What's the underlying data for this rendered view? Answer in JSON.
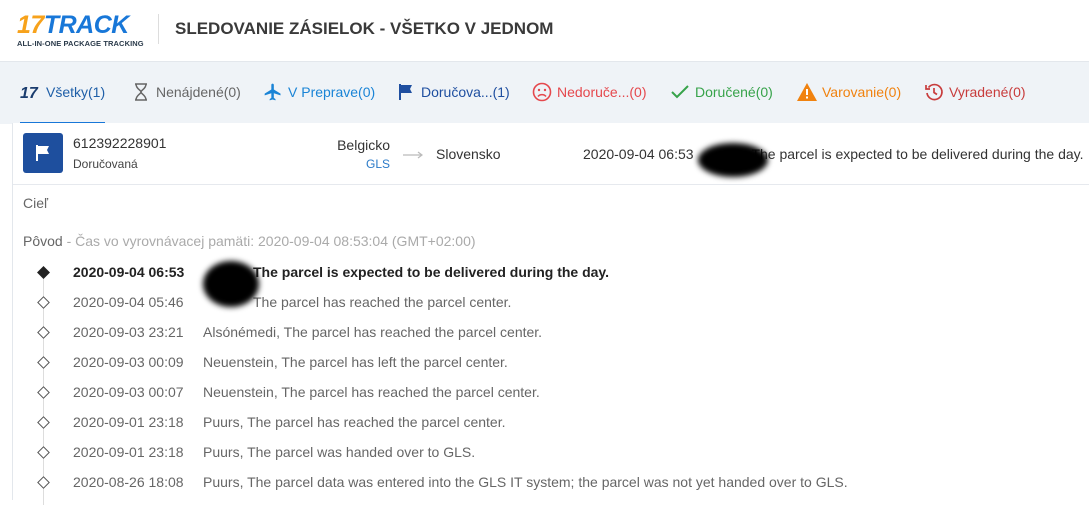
{
  "header": {
    "logo_number": "17",
    "logo_word": "TRACK",
    "logo_tagline": "ALL-IN-ONE PACKAGE TRACKING",
    "title": "SLEDOVANIE ZÁSIELOK - VŠETKO V JEDNOM"
  },
  "tabs": [
    {
      "label": "Všetky(1)",
      "icon": "17-icon"
    },
    {
      "label": "Nenájdené(0)",
      "icon": "hourglass-icon"
    },
    {
      "label": "V Preprave(0)",
      "icon": "airplane-icon"
    },
    {
      "label": "Doručova...(1)",
      "icon": "flag-icon"
    },
    {
      "label": "Nedoruče...(0)",
      "icon": "sad-face-icon"
    },
    {
      "label": "Doručené(0)",
      "icon": "check-icon"
    },
    {
      "label": "Varovanie(0)",
      "icon": "warning-icon"
    },
    {
      "label": "Vyradené(0)",
      "icon": "history-icon"
    }
  ],
  "shipment": {
    "tracking_number": "612392228901",
    "status": "Doručovaná",
    "origin_country": "Belgicko",
    "carrier": "GLS",
    "destination_country": "Slovensko",
    "last_event_time": "2020-09-04 06:53",
    "last_event_text": "The parcel is expected to be delivered during the day."
  },
  "sections": {
    "destination_label": "Cieľ",
    "origin_label": "Pôvod",
    "cache_note": " - Čas vo vyrovnávacej pamäti: 2020-09-04 08:53:04 (GMT+02:00)"
  },
  "events": [
    {
      "time": "2020-09-04 06:53",
      "text": "The parcel is expected to be delivered during the day."
    },
    {
      "time": "2020-09-04 05:46",
      "text": "The parcel has reached the parcel center."
    },
    {
      "time": "2020-09-03 23:21",
      "text": "Alsónémedi, The parcel has reached the parcel center."
    },
    {
      "time": "2020-09-03 00:09",
      "text": "Neuenstein, The parcel has left the parcel center."
    },
    {
      "time": "2020-09-03 00:07",
      "text": "Neuenstein, The parcel has reached the parcel center."
    },
    {
      "time": "2020-09-01 23:18",
      "text": "Puurs, The parcel has reached the parcel center."
    },
    {
      "time": "2020-09-01 23:18",
      "text": "Puurs, The parcel was handed over to GLS."
    },
    {
      "time": "2020-08-26 18:08",
      "text": "Puurs, The parcel data was entered into the GLS IT system; the parcel was not yet handed over to GLS."
    }
  ],
  "colors": {
    "brand_blue": "#1877d8",
    "brand_orange": "#f7a21b",
    "tab_bar_bg": "#eff3f7",
    "status_flag_bg": "#1e4f9e"
  }
}
